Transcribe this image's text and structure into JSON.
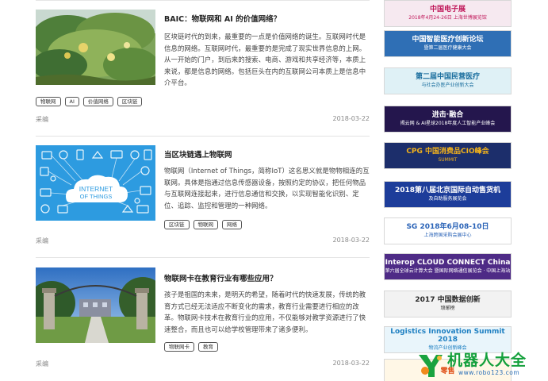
{
  "articles": [
    {
      "title": "BAIC：物联网和 AI 的价值网络？",
      "desc": "区块链时代的到来，最重要的一点是价值网络的诞生。互联网时代是信息的网络。互联网时代，最重要的是完成了现实世界信息的上网。从一开始的门户，到后来的搜索、电商、游戏和共享经济等，本质上来说，都是信息的网络。包括巨头在内的互联网公司本质上是信息中介平台。",
      "tags": [
        "物联网",
        "AI",
        "价值网络",
        "区块链"
      ],
      "source": "采编",
      "date": "2018-03-22"
    },
    {
      "title": "当区块链遇上物联网",
      "desc": "物联网（Internet of Things，简称IoT）这名思义就是物物相连的互联网。具体是指通过信息传感器设备，按照约定的协议，把任何物品与互联网连接起来，进行信息通信和交换，以实现智能化识别、定位、追踪、监控和管理的一种网络。",
      "tags": [
        "区块链",
        "物联网",
        "网络"
      ],
      "source": "采编",
      "date": "2018-03-22",
      "image_text": [
        "INTERNET",
        "OF THINGS"
      ]
    },
    {
      "title": "物联网卡在教育行业有哪些应用？",
      "desc": "孩子是祖国的未来，是明天的希望，随着时代的快速发展，传统的教育方式已经无法适应不断变化的需求，教育行业需要进行相应的改革。物联网卡技术在教育行业的应用，不仅能够对教学资源进行了快速整合，而且也可以给学校管理带来了诸多便利。",
      "tags": [
        "物联网卡",
        "教育"
      ],
      "source": "采编",
      "date": "2018-03-22"
    }
  ],
  "sidebar_banners": [
    {
      "line1": "中国电子展",
      "line2": "2018年4月24-26日 上海世博展览馆",
      "bg": "#f6e9f0",
      "fg": "#c0185a"
    },
    {
      "line1": "中国智能医疗创新论坛",
      "line2": "暨第二届医疗健康大会",
      "bg": "#2f6fb5",
      "fg": "#ffffff"
    },
    {
      "line1": "第二届中国民营医疗",
      "line2": "与社会办医产业创新大会",
      "bg": "#dff1f6",
      "fg": "#1a6e9e"
    },
    {
      "line1": "进击·融合",
      "line2": "揭云网 & AI星球2018年度人工智能产业峰会",
      "bg": "#24164d",
      "fg": "#ffffff"
    },
    {
      "line1": "CPG 中国消费品CIO峰会",
      "line2": "SUMMIT",
      "bg": "#1c2e6b",
      "fg": "#f2b21b"
    },
    {
      "line1": "2018第八届北京国际自动售货机",
      "line2": "及自助服务展览会",
      "bg": "#1d3d9a",
      "fg": "#ffffff"
    },
    {
      "line1": "SG 2018年6月08-10日",
      "line2": "上海跨国采购会展中心",
      "bg": "#ffffff",
      "fg": "#2a63b7"
    },
    {
      "line1": "Interop CLOUD CONNECT China",
      "line2": "第六届全球云计算大会 暨国际网络通信展览会 · 中国上海站",
      "bg": "#4e2b86",
      "fg": "#ffffff"
    },
    {
      "line1": "2017 中国数据创新",
      "line2": "琅琊榜",
      "bg": "#f2f2f2",
      "fg": "#2b2b2b"
    },
    {
      "line1": "Logistics Innovation Summit 2018",
      "line2": "物流产业创新峰会",
      "bg": "#e9f5fb",
      "fg": "#1f80c2"
    },
    {
      "line1": "零售",
      "line2": "",
      "bg": "#fff7e6",
      "fg": "#e0521b"
    }
  ],
  "logo": {
    "name": "机器人大全",
    "url": "www.robo123.com"
  }
}
